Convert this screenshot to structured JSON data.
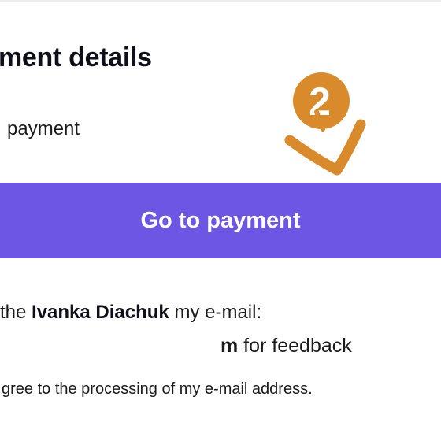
{
  "heading": {
    "title": "ment details"
  },
  "payment_option": {
    "label": "payment"
  },
  "step_marker": {
    "number": "2",
    "color": "#d98a2a"
  },
  "pay_button": {
    "label": "Go to payment",
    "color": "#6c56e3"
  },
  "consent": {
    "prefix": "the ",
    "name": "Ivanka Diachuk",
    "suffix": " my e-mail:",
    "email_tail": "m",
    "feedback": " for feedback",
    "agree_text": "gree to the processing of my e-mail address."
  }
}
